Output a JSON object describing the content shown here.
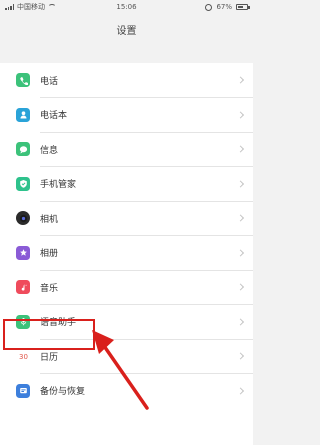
{
  "status_bar": {
    "carrier": "中国移动",
    "time": "15:06",
    "battery_text": "67%",
    "battery_level": 0.67
  },
  "header": {
    "title": "设置"
  },
  "settings": [
    {
      "label": "电话",
      "icon": "phone-icon",
      "color": "#3cc27a"
    },
    {
      "label": "电话本",
      "icon": "contacts-icon",
      "color": "#2aa3d8"
    },
    {
      "label": "信息",
      "icon": "message-icon",
      "color": "#3cc27a"
    },
    {
      "label": "手机管家",
      "icon": "shield-icon",
      "color": "#2ec28c"
    },
    {
      "label": "相机",
      "icon": "camera-icon",
      "color": "#2b2b2b"
    },
    {
      "label": "相册",
      "icon": "gallery-icon",
      "color": "#8a5bd6"
    },
    {
      "label": "音乐",
      "icon": "music-icon",
      "color": "#ef4b5c"
    },
    {
      "label": "语音助手",
      "icon": "microphone-icon",
      "color": "#3cc27a"
    },
    {
      "label": "日历",
      "icon": "calendar-icon",
      "color": "#e1564a"
    },
    {
      "label": "备份与恢复",
      "icon": "backup-icon",
      "color": "#3d7fdc"
    }
  ],
  "annotation": {
    "color": "#d9201c"
  }
}
